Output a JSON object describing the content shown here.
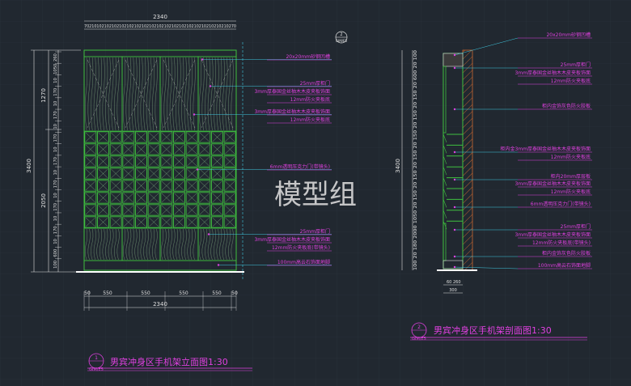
{
  "colors": {
    "background": "#212830",
    "grid": "#2a323c",
    "cabinet_green": "#3fbf3f",
    "annotation_magenta": "#e040e0",
    "dimension_white": "#e0e0e0",
    "cyan_leader": "#40c8e0",
    "hatch_orange": "#e07030"
  },
  "watermark": "模型组",
  "elevation": {
    "title": "男宾冲身区手机架立面图1:30",
    "badge_number": "1",
    "badge_ref": "GIM/E5",
    "section_marker": "2",
    "section_marker_ref": "GIM/E5",
    "top_total": "2340",
    "top_cells": "7021010210210210210210210210210210210210210210210210210210270",
    "bottom_dims": [
      "50",
      "550",
      "550",
      "550",
      "550",
      "50"
    ],
    "bottom_total": "2340",
    "left_total": "3400",
    "left_upper": "1270",
    "left_lower": "2050",
    "left_col_a": [
      "260",
      "1050",
      "10",
      "170",
      "10",
      "170",
      "10",
      "170",
      "10",
      "170",
      "10",
      "170",
      "10",
      "170",
      "10",
      "170",
      "10",
      "600",
      "100"
    ],
    "notes": [
      "20x20mm砂钢凹槽",
      "25mm厚柜门",
      "3mm厚泰国金丝柚木木皮夹板饰面",
      "12mm防火夹板底",
      "3mm厚泰国金丝柚木木皮夹板饰面",
      "12mm防火夹板底",
      "6mm透明压克力门(带镜头)",
      "25mm厚柜门",
      "3mm厚泰国金丝柚木木皮夹板饰面",
      "12mm防火夹板底(带镜头)",
      "100mm高云石饰面地脚"
    ]
  },
  "section": {
    "title": "男宾冲身区手机架剖面图1:30",
    "badge_number": "2",
    "badge_ref": "GIM/E5",
    "left_total": "3400",
    "left_cells": "100 20 180 2000 1050 20 150 20 150 20 150 20 150 20 150 20 150 20 600 20 100",
    "bottom_dims": [
      "60",
      "260",
      "300"
    ],
    "notes": [
      "20x20mm砂钢凹槽",
      "25mm厚柜门",
      "3mm厚泰国金丝柚木木皮夹板饰面",
      "12mm防火夹板底",
      "柜内金饰灰色防火胶板",
      "柜内金3mm厚泰国金丝柚木木皮夹板饰面",
      "12mm防火夹板底",
      "柜内20mm厚层板",
      "3mm厚泰国金丝柚木木皮夹板饰面",
      "12mm防火夹板底",
      "6mm透明压克力门(带镜头)",
      "25mm厚柜门",
      "3mm厚泰国金丝柚木木皮夹板饰面",
      "12mm防火夹板底(带镜头)",
      "柜内金饰灰色防火胶板",
      "100mm高云石饰面地脚"
    ]
  }
}
